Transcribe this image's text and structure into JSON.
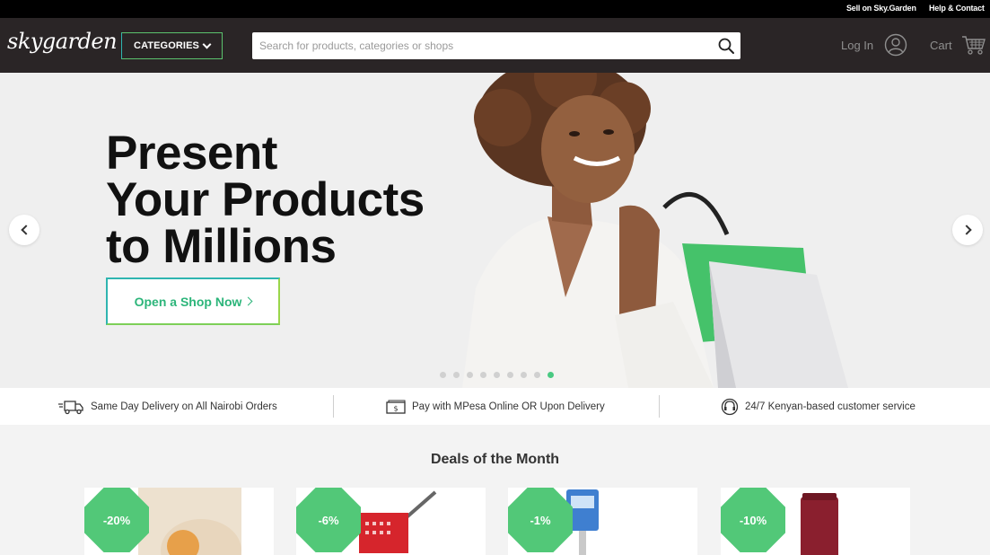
{
  "topbar": {
    "sell": "Sell on Sky.Garden",
    "help": "Help & Contact"
  },
  "header": {
    "logo": "skygarden",
    "categories_label": "CATEGORIES",
    "search_placeholder": "Search for products, categories or shops",
    "login_label": "Log In",
    "cart_label": "Cart"
  },
  "hero": {
    "headline": [
      "Present",
      "Your Products",
      "to Millions"
    ],
    "cta_label": "Open a Shop Now",
    "slide_count": 9,
    "active_slide": 9
  },
  "strip": {
    "delivery": "Same Day Delivery on All Nairobi Orders",
    "payment": "Pay with MPesa Online OR Upon Delivery",
    "service": "24/7 Kenyan-based customer service"
  },
  "deals": {
    "title": "Deals of the Month",
    "items": [
      {
        "discount": "-20%"
      },
      {
        "discount": "-6%"
      },
      {
        "discount": "-1%"
      },
      {
        "discount": "-10%"
      }
    ]
  },
  "colors": {
    "accent": "#52c878",
    "header_bg": "#2a2526",
    "teal": "#2fb5b0"
  }
}
